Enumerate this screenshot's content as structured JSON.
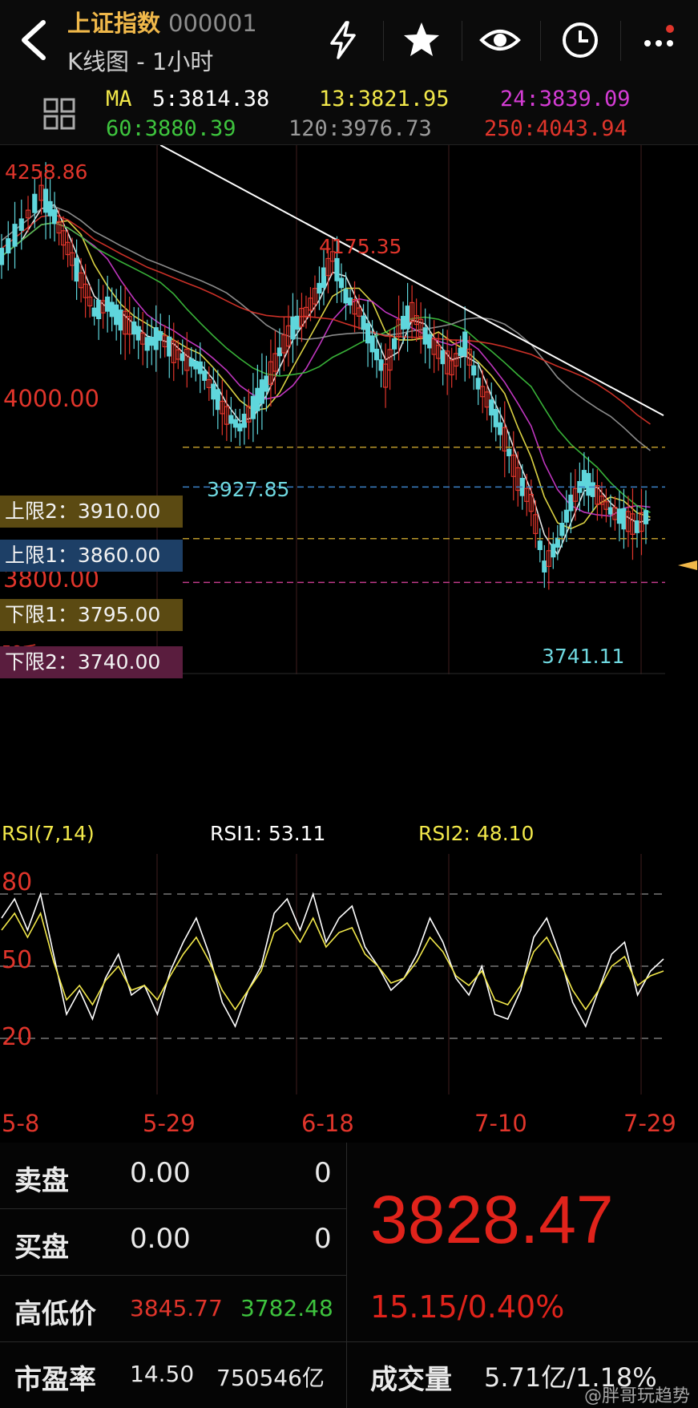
{
  "header": {
    "title": "上证指数",
    "code": "000001",
    "subtitle": "K线图 - 1小时",
    "icons": [
      "back-icon",
      "lightning-icon",
      "star-icon",
      "eye-icon",
      "clock-icon",
      "more-icon"
    ]
  },
  "ma": {
    "label": "MA",
    "ma5": "5:3814.38",
    "ma13": "13:3821.95",
    "ma24": "24:3839.09",
    "ma60": "60:3880.39",
    "ma120": "120:3976.73",
    "ma250": "250:4043.94",
    "colors": {
      "ma5": "#ffffff",
      "ma13": "#f2e84a",
      "ma24": "#d43cd4",
      "ma60": "#3ec43e",
      "ma120": "#9a9a9a",
      "ma250": "#e0352b"
    }
  },
  "annotations": {
    "high": "4258.86",
    "peak2": "4175.35",
    "level4000": "4000.00",
    "low1": "3927.85",
    "level3800": "3800.00",
    "low2": "3741.11",
    "vol_label": "58千"
  },
  "limits": {
    "upper2": {
      "label": "上限2：3910.00",
      "color": "#b8962a"
    },
    "upper1": {
      "label": "上限1：3860.00",
      "color": "#3a7fc4"
    },
    "lower1": {
      "label": "下限1：3795.00",
      "color": "#b8962a"
    },
    "lower2": {
      "label": "下限2：3740.00",
      "color": "#c23a8a"
    }
  },
  "rsi": {
    "title": "RSI(7,14)",
    "rsi1": "RSI1: 53.11",
    "rsi2": "RSI2: 48.10",
    "levels": [
      "80",
      "50",
      "20"
    ]
  },
  "dates": [
    "5-8",
    "5-29",
    "6-18",
    "7-10",
    "7-29"
  ],
  "quote": {
    "sell_label": "卖盘",
    "sell_price": "0.00",
    "sell_vol": "0",
    "buy_label": "买盘",
    "buy_price": "0.00",
    "buy_vol": "0",
    "hl_label": "高低价",
    "high": "3845.77",
    "low": "3782.48",
    "pe_label": "市盈率",
    "pe": "14.50",
    "mktcap": "750546亿",
    "last": "3828.47",
    "change": "15.15/0.40%",
    "vol_label": "成交量",
    "vol": "5.71亿/1.18%"
  },
  "watermark": "@胖哥玩趋势",
  "chart_data": {
    "type": "candlestick",
    "title": "上证指数 K线图 - 1小时",
    "x_ticks": [
      "5-8",
      "5-29",
      "6-18",
      "7-10",
      "7-29"
    ],
    "ylim": [
      3700,
      4290
    ],
    "close_path": [
      [
        0,
        4150
      ],
      [
        3,
        4190
      ],
      [
        6,
        4230
      ],
      [
        8,
        4200
      ],
      [
        10,
        4160
      ],
      [
        12,
        4120
      ],
      [
        14,
        4080
      ],
      [
        16,
        4090
      ],
      [
        18,
        4070
      ],
      [
        20,
        4060
      ],
      [
        22,
        4040
      ],
      [
        24,
        4050
      ],
      [
        26,
        4030
      ],
      [
        28,
        4020
      ],
      [
        30,
        4010
      ],
      [
        32,
        3980
      ],
      [
        34,
        3950
      ],
      [
        36,
        3935
      ],
      [
        38,
        3960
      ],
      [
        40,
        3990
      ],
      [
        42,
        4030
      ],
      [
        44,
        4060
      ],
      [
        46,
        4080
      ],
      [
        48,
        4110
      ],
      [
        50,
        4150
      ],
      [
        52,
        4100
      ],
      [
        54,
        4080
      ],
      [
        56,
        4040
      ],
      [
        58,
        4000
      ],
      [
        60,
        4060
      ],
      [
        62,
        4080
      ],
      [
        64,
        4050
      ],
      [
        66,
        4030
      ],
      [
        68,
        4010
      ],
      [
        70,
        4040
      ],
      [
        72,
        3990
      ],
      [
        74,
        3960
      ],
      [
        76,
        3920
      ],
      [
        78,
        3870
      ],
      [
        80,
        3840
      ],
      [
        82,
        3760
      ],
      [
        84,
        3790
      ],
      [
        86,
        3840
      ],
      [
        88,
        3870
      ],
      [
        90,
        3850
      ],
      [
        92,
        3830
      ],
      [
        94,
        3820
      ],
      [
        96,
        3810
      ],
      [
        98,
        3828
      ]
    ],
    "trendline": [
      [
        24,
        4290
      ],
      [
        100,
        3950
      ]
    ],
    "ma_series": [
      {
        "name": "MA5",
        "color": "#ffffff",
        "value": 3814.38
      },
      {
        "name": "MA13",
        "color": "#f2e84a",
        "value": 3821.95
      },
      {
        "name": "MA24",
        "color": "#d43cd4",
        "value": 3839.09
      },
      {
        "name": "MA60",
        "color": "#3ec43e",
        "value": 3880.39
      },
      {
        "name": "MA120",
        "color": "#9a9a9a",
        "value": 3976.73
      },
      {
        "name": "MA250",
        "color": "#e0352b",
        "value": 4043.94
      }
    ],
    "limits": [
      3910,
      3860,
      3795,
      3740
    ],
    "rsi_series": [
      {
        "name": "RSI1",
        "color": "#ffffff",
        "last": 53.11,
        "values": [
          70,
          78,
          65,
          80,
          55,
          30,
          40,
          28,
          45,
          55,
          38,
          42,
          30,
          48,
          60,
          70,
          55,
          35,
          25,
          40,
          50,
          72,
          78,
          65,
          80,
          60,
          70,
          75,
          58,
          50,
          40,
          45,
          55,
          70,
          60,
          45,
          38,
          50,
          30,
          28,
          40,
          62,
          70,
          55,
          35,
          25,
          40,
          55,
          60,
          38,
          48,
          53
        ]
      },
      {
        "name": "RSI2",
        "color": "#f2e84a",
        "last": 48.1,
        "values": [
          65,
          72,
          62,
          72,
          52,
          36,
          42,
          34,
          44,
          50,
          40,
          42,
          36,
          46,
          55,
          62,
          52,
          40,
          32,
          40,
          48,
          64,
          68,
          60,
          70,
          58,
          64,
          66,
          55,
          50,
          43,
          45,
          52,
          62,
          56,
          46,
          42,
          48,
          36,
          34,
          42,
          56,
          62,
          52,
          40,
          32,
          40,
          50,
          54,
          42,
          46,
          48
        ]
      }
    ]
  }
}
